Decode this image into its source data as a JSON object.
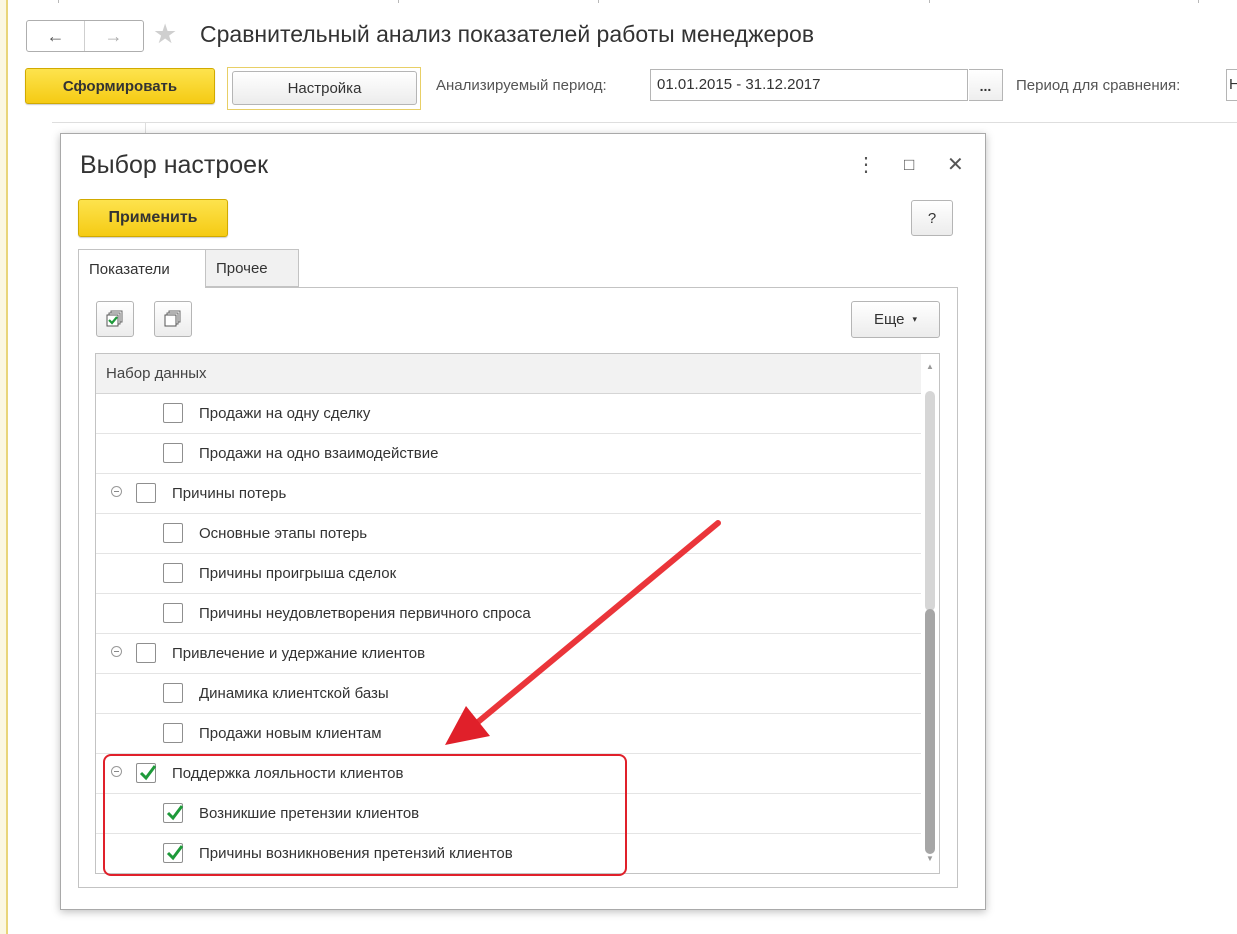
{
  "window": {
    "title": "Сравнительный анализ показателей работы менеджеров",
    "nav": {
      "back_icon": "←",
      "forward_icon": "→",
      "star_icon": "★"
    }
  },
  "toolbar": {
    "generate_label": "Сформировать",
    "settings_label": "Настройка",
    "period_label": "Анализируемый период:",
    "period_value": "01.01.2015 - 31.12.2017",
    "period_picker_label": "...",
    "compare_label": "Период для сравнения:",
    "compare_value": "Н"
  },
  "dialog": {
    "title": "Выбор настроек",
    "menu_icon": "⋮",
    "maximize_icon": "□",
    "close_icon": "✕",
    "apply_label": "Применить",
    "help_label": "?",
    "tabs": [
      {
        "label": "Показатели",
        "active": true
      },
      {
        "label": "Прочее",
        "active": false
      }
    ],
    "more_label": "Еще",
    "more_arrow": "▾",
    "table": {
      "header": "Набор данных",
      "rows": [
        {
          "label": "Продажи на одну сделку",
          "level": 1,
          "checked": false
        },
        {
          "label": "Продажи на одно взаимодействие",
          "level": 1,
          "checked": false
        },
        {
          "label": "Причины потерь",
          "level": 0,
          "checked": false
        },
        {
          "label": "Основные этапы потерь",
          "level": 1,
          "checked": false
        },
        {
          "label": "Причины проигрыша сделок",
          "level": 1,
          "checked": false
        },
        {
          "label": "Причины неудовлетворения первичного спроса",
          "level": 1,
          "checked": false
        },
        {
          "label": "Привлечение и удержание клиентов",
          "level": 0,
          "checked": false
        },
        {
          "label": "Динамика клиентской базы",
          "level": 1,
          "checked": false
        },
        {
          "label": "Продажи новым клиентам",
          "level": 1,
          "checked": false
        },
        {
          "label": "Поддержка лояльности клиентов",
          "level": 0,
          "checked": true
        },
        {
          "label": "Возникшие претензии клиентов",
          "level": 1,
          "checked": true
        },
        {
          "label": "Причины возникновения претензий клиентов",
          "level": 1,
          "checked": true
        }
      ]
    }
  },
  "colors": {
    "accent_yellow": "#f5cb14",
    "check_green": "#1e9a3a",
    "annotation_red": "#e0202a"
  }
}
